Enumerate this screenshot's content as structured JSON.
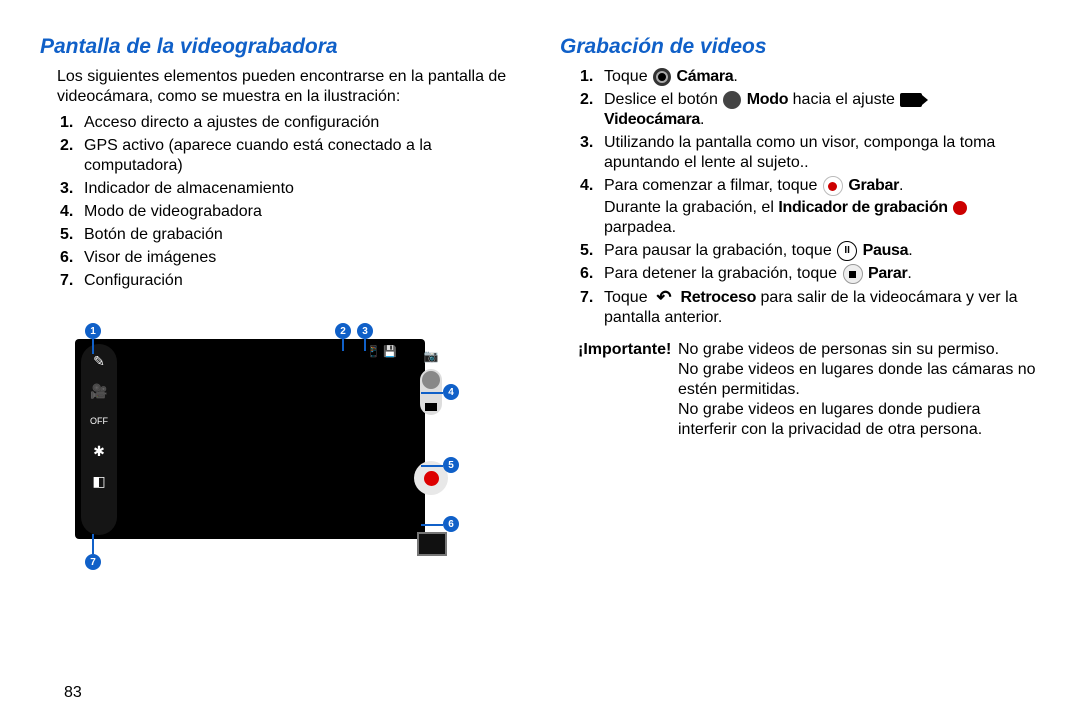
{
  "pageNumber": "83",
  "left": {
    "heading": "Pantalla de la videograbadora",
    "intro": "Los siguientes elementos pueden encontrarse en la pantalla de videocámara, como se muestra en la ilustración:",
    "items": [
      "Acceso directo a ajustes de configuración",
      "GPS activo (aparece cuando está conectado a la computadora)",
      "Indicador de almacenamiento",
      "Modo de videograbadora",
      "Botón de grabación",
      "Visor de imágenes",
      "Configuración"
    ],
    "figure": {
      "callouts": [
        "1",
        "2",
        "3",
        "4",
        "5",
        "6",
        "7"
      ],
      "icons": {
        "settingsShortcut": "settings-shortcut-icon",
        "camcorder": "camcorder-icon",
        "flashOff": "flash-off-icon",
        "effects": "effects-icon",
        "exposure": "exposure-icon",
        "gear": "gear-icon",
        "gps": "gps-icon",
        "storage": "storage-icon",
        "modeCamera": "camera-mode-icon",
        "modeVideo": "video-mode-icon",
        "record": "record-button",
        "gallery": "gallery-thumb"
      },
      "status": "□ ◂"
    }
  },
  "right": {
    "heading": "Grabación de videos",
    "step1": {
      "pre": "Toque ",
      "bold": "Cámara",
      "post": "."
    },
    "step2": {
      "pre": "Deslice el botón ",
      "bold1": "Modo",
      "mid": " hacia el ajuste ",
      "bold2": "Videocámara",
      "post": "."
    },
    "step3": "Utilizando la pantalla como un visor, componga la toma apuntando el lente al sujeto..",
    "step4": {
      "pre": "Para comenzar a filmar, toque ",
      "bold": "Grabar",
      "post": ".",
      "cont_pre": "Durante la grabación, el ",
      "cont_bold": "Indicador de grabación",
      "cont_post": " parpadea."
    },
    "step5": {
      "pre": "Para pausar la grabación, toque ",
      "bold": "Pausa",
      "post": "."
    },
    "step6": {
      "pre": "Para detener la grabación, toque ",
      "bold": "Parar",
      "post": "."
    },
    "step7": {
      "pre": "Toque ",
      "bold": "Retroceso",
      "post": " para salir de la videocámara y ver la pantalla anterior."
    },
    "important": {
      "label": "¡Importante!",
      "body1": "No grabe videos de personas sin su permiso.",
      "body2": "No grabe videos en lugares donde las cámaras no estén permitidas.",
      "body3": "No grabe videos en lugares donde pudiera interferir con la privacidad de otra persona."
    }
  }
}
